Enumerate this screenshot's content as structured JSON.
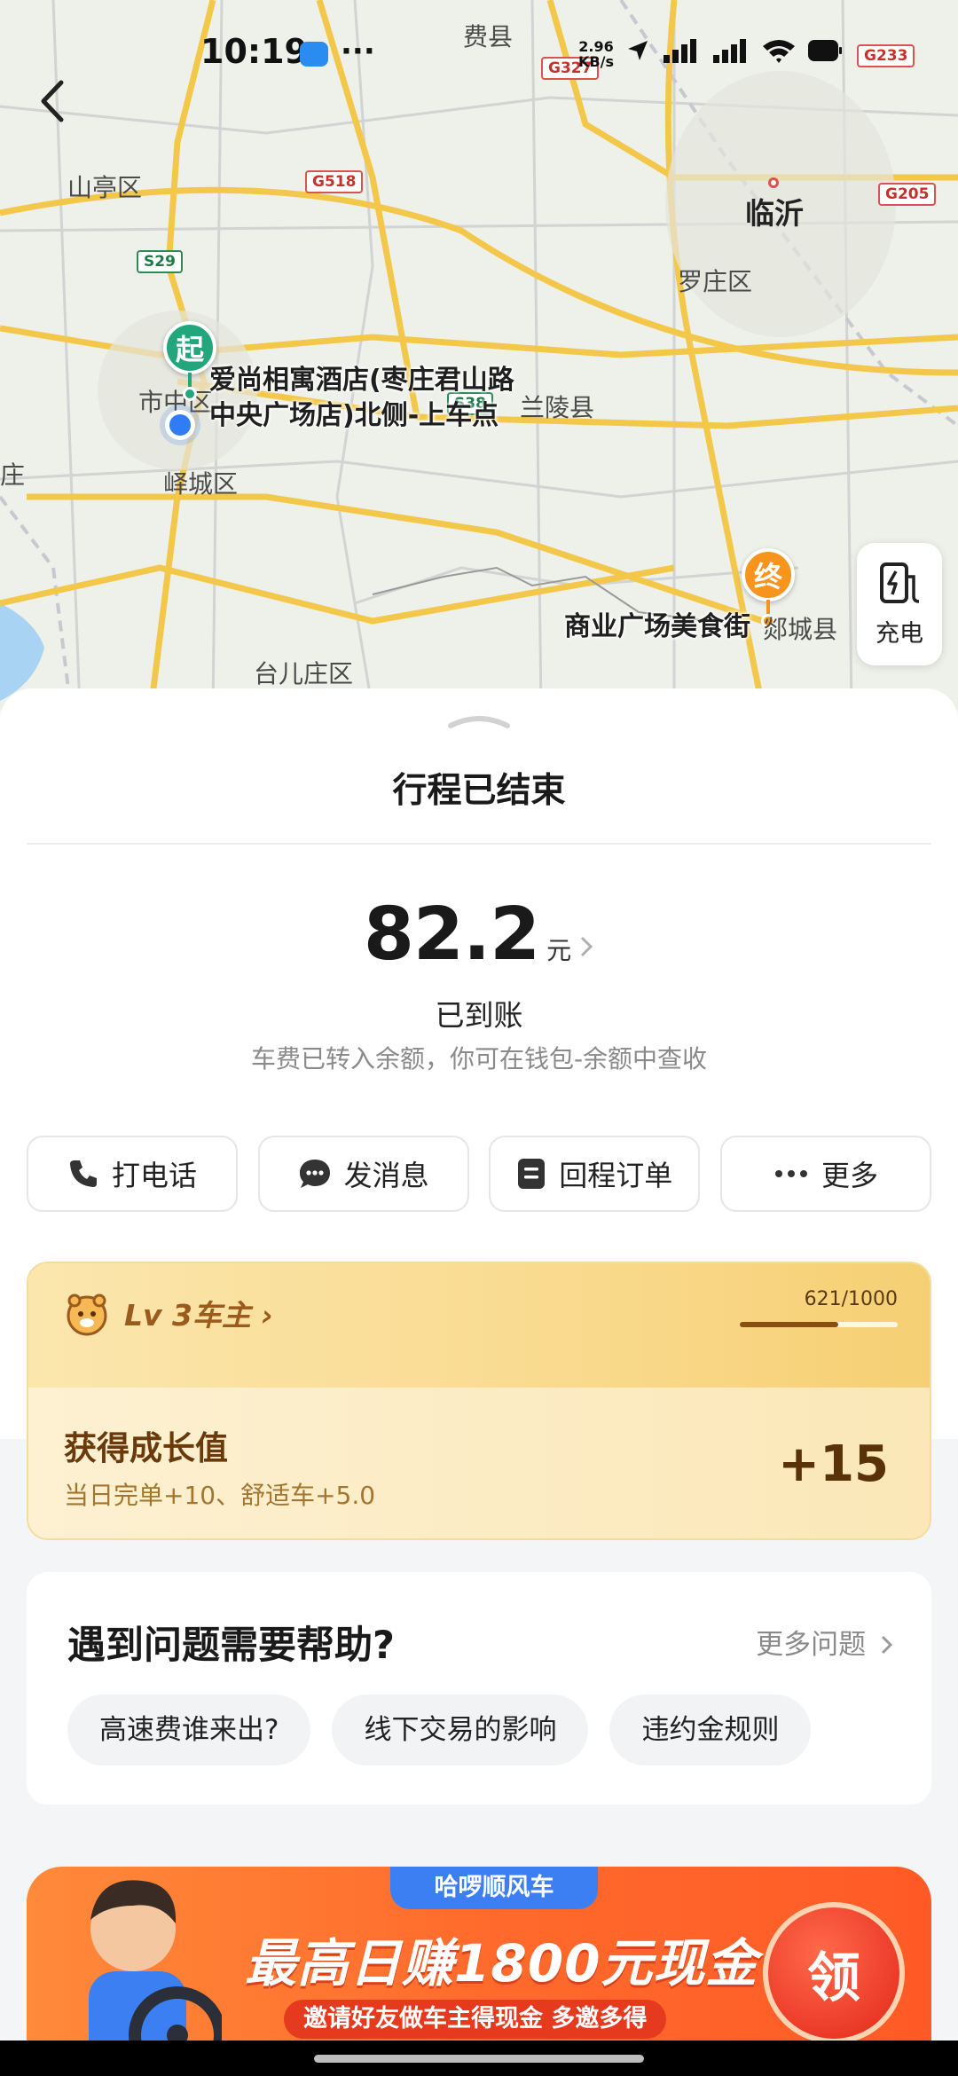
{
  "status_bar": {
    "time": "10:19",
    "more_indicator": "···",
    "net_speed": "2.96",
    "net_unit": "KB/s"
  },
  "map": {
    "labels": {
      "feixian": "费县",
      "shanting": "山亭区",
      "linyi": "临沂",
      "luozhuang": "罗庄区",
      "lanling": "兰陵县",
      "shizhong": "市中区",
      "yicheng": "峄城区",
      "taierzhuang": "台儿庄区",
      "zhuang": "庄"
    },
    "roads": {
      "g327": "G327",
      "g518": "G518",
      "s29": "S29",
      "g205": "G205",
      "g233": "G233",
      "s38": "S38"
    },
    "start_pin": "起",
    "end_pin": "终",
    "start_place_line1": "爱尚相寓酒店(枣庄君山路",
    "start_place_line2": "中央广场店)北侧-上车点",
    "end_place": "商业广场美食街",
    "end_county": "郯城县",
    "charge_label": "充电",
    "icons": {
      "back": "chevron-left-icon",
      "charge": "charging-pile-icon"
    }
  },
  "trip": {
    "title": "行程已结束",
    "amount": "82.2",
    "unit": "元",
    "status": "已到账",
    "note": "车费已转入余额，你可在钱包-余额中查收"
  },
  "actions": [
    {
      "label": "打电话",
      "icon": "phone-icon"
    },
    {
      "label": "发消息",
      "icon": "chat-icon"
    },
    {
      "label": "回程订单",
      "icon": "order-icon"
    },
    {
      "label": "更多",
      "icon": "more-dots-icon"
    }
  ],
  "level": {
    "name": "Lv 3车主",
    "progress_text": "621/1000",
    "progress": 0.621,
    "growth_title": "获得成长值",
    "growth_detail": "当日完单+10、舒适车+5.0",
    "growth_points": "+15",
    "colors": {
      "accent": "#9a5b1d",
      "bar": "#8a4d12"
    }
  },
  "help": {
    "title": "遇到问题需要帮助?",
    "more": "更多问题",
    "chips": [
      "高速费谁来出?",
      "线下交易的影响",
      "违约金规则"
    ]
  },
  "promo": {
    "tag": "哈啰顺风车",
    "main": "最高日赚1800元现金",
    "sub": "邀请好友做车主得现金 多邀多得",
    "claim": "领"
  }
}
